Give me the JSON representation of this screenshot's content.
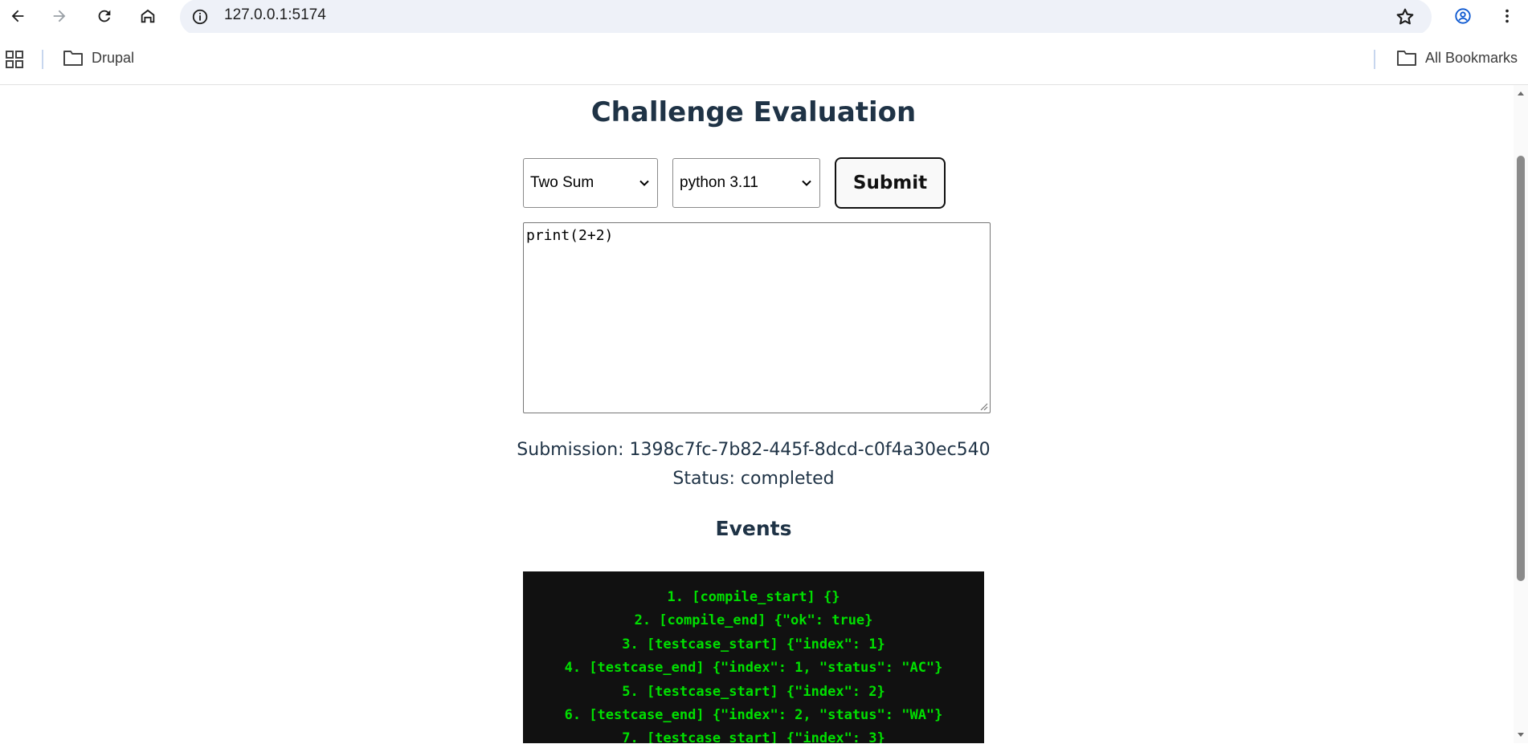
{
  "browser": {
    "url": "127.0.0.1:5174",
    "bookmarks": [
      {
        "label": "Drupal",
        "icon": "folder-icon"
      }
    ],
    "all_bookmarks_label": "All Bookmarks"
  },
  "page": {
    "title": "Challenge Evaluation",
    "problem_select": {
      "selected": "Two Sum"
    },
    "language_select": {
      "selected": "python 3.11"
    },
    "submit_label": "Submit",
    "code": "print(2+2)",
    "submission_line": "Submission: 1398c7fc-7b82-445f-8dcd-c0f4a30ec540",
    "status_line": "Status: completed",
    "events_title": "Events",
    "events": [
      "1. [compile_start] {}",
      "2. [compile_end] {\"ok\": true}",
      "3. [testcase_start] {\"index\": 1}",
      "4. [testcase_end] {\"index\": 1, \"status\": \"AC\"}",
      "5. [testcase_start] {\"index\": 2}",
      "6. [testcase_end] {\"index\": 2, \"status\": \"WA\"}",
      "7. [testcase_start] {\"index\": 3}"
    ]
  },
  "colors": {
    "heading": "#1f3346",
    "log_bg": "#111111",
    "log_text": "#00e000",
    "omnibox_bg": "#eef1f8"
  }
}
